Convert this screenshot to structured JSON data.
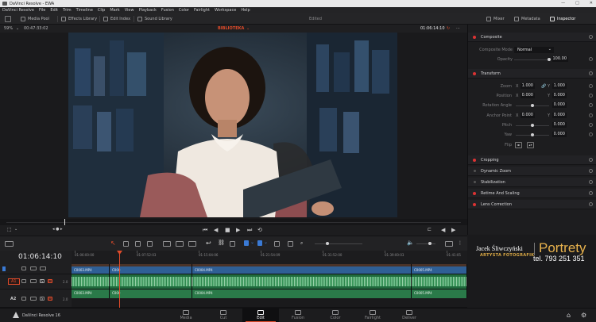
{
  "window": {
    "title": "DaVinci Resolve - EWA"
  },
  "menu": [
    "DaVinci Resolve",
    "File",
    "Edit",
    "Trim",
    "Timeline",
    "Clip",
    "Mark",
    "View",
    "Playback",
    "Fusion",
    "Color",
    "Fairlight",
    "Workspace",
    "Help"
  ],
  "toolbar": {
    "media_pool": "Media Pool",
    "effects_library": "Effects Library",
    "edit_index": "Edit Index",
    "sound_library": "Sound Library",
    "status": "Edited",
    "mixer": "Mixer",
    "metadata": "Metadata",
    "inspector": "Inspector"
  },
  "viewer": {
    "zoom": "59%",
    "duration": "00:47:33:02",
    "timeline_name": "BIBLIOTEKA",
    "timecode": "01:06:14:10"
  },
  "inspector": {
    "composite": {
      "title": "Composite",
      "mode_label": "Composite Mode",
      "mode_value": "Normal",
      "opacity_label": "Opacity",
      "opacity_value": "100.00"
    },
    "transform": {
      "title": "Transform",
      "zoom_label": "Zoom",
      "zoom_x": "1.000",
      "zoom_y": "1.000",
      "position_label": "Position",
      "position_x": "0.000",
      "position_y": "0.000",
      "rotation_label": "Rotation Angle",
      "rotation_value": "0.000",
      "anchor_label": "Anchor Point",
      "anchor_x": "0.000",
      "anchor_y": "0.000",
      "pitch_label": "Pitch",
      "pitch_value": "0.000",
      "yaw_label": "Yaw",
      "yaw_value": "0.000",
      "flip_label": "Flip",
      "x_axis": "X",
      "y_axis": "Y"
    },
    "sections": [
      "Cropping",
      "Dynamic Zoom",
      "Stabilization",
      "Retime And Scaling",
      "Lens Correction"
    ]
  },
  "timeline": {
    "timecode": "01:06:14:10",
    "ruler": [
      "01:06:00:00",
      "01:07:52:03",
      "01:15:04:06",
      "01:21:54:09",
      "01:31:52:00",
      "01:39:00:03",
      "01:41:05"
    ],
    "tracks": [
      "V1",
      "A1",
      "A2"
    ],
    "track_level": "2.0",
    "clips_video": [
      "C0003.MP4",
      "C000",
      "C0004.MP4",
      "C0005.MP4"
    ],
    "clips_audio": [
      "C0003.MP4",
      "C000",
      "C0004.MP4",
      "C0005.MP4"
    ]
  },
  "watermark": {
    "name": "Jacek Śliwczyński",
    "subtitle": "ARTYSTA FOTOGRAFIK",
    "brand": "Portrety",
    "phone": "tel. 793 251 351"
  },
  "pages": [
    "Media",
    "Cut",
    "Edit",
    "Fusion",
    "Color",
    "Fairlight",
    "Deliver"
  ],
  "active_page": "Edit",
  "footer": {
    "app": "DaVinci Resolve 16"
  },
  "colors": {
    "accent": "#e14b2a",
    "video_clip": "#2f5f95",
    "audio_clip": "#1f6b3d",
    "brand": "#e8b24d"
  }
}
